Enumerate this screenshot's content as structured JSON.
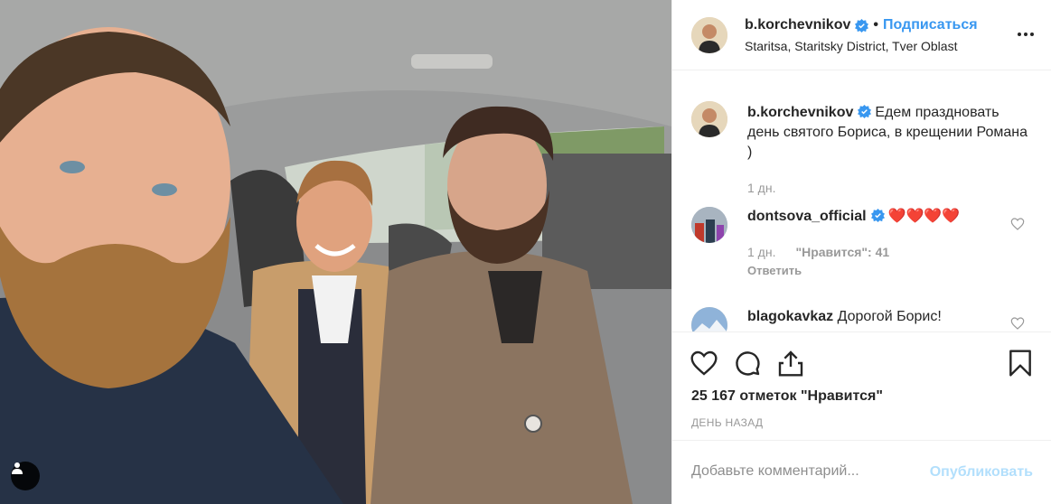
{
  "post": {
    "username": "b.korchevnikov",
    "verified": true,
    "separator": "•",
    "follow_label": "Подписаться",
    "location": "Staritsa, Staritsky District, Tver Oblast",
    "more_icon": "more-horizontal-icon"
  },
  "caption": {
    "username": "b.korchevnikov",
    "text": "Едем праздновать день святого Бориса, в крещении Романа )",
    "time": "1 дн."
  },
  "comments": [
    {
      "username": "dontsova_official",
      "text": "❤️❤️❤️❤️",
      "time": "1 дн.",
      "likes": "\"Нравится\": 41",
      "reply_label": "Ответить"
    },
    {
      "username": "blagokavkaz",
      "text": "Дорогой Борис!"
    }
  ],
  "actions": {
    "like_icon": "heart-icon",
    "comment_icon": "comment-icon",
    "share_icon": "share-icon",
    "save_icon": "bookmark-icon"
  },
  "likes_text": "25 167 отметок \"Нравится\"",
  "date_text": "день назад",
  "add_comment": {
    "placeholder": "Добавьте комментарий...",
    "publish_label": "Опубликовать"
  },
  "colors": {
    "accent": "#3897f0",
    "publish_disabled": "#b2dffc",
    "heart": "#ed4956",
    "muted": "#999999"
  }
}
